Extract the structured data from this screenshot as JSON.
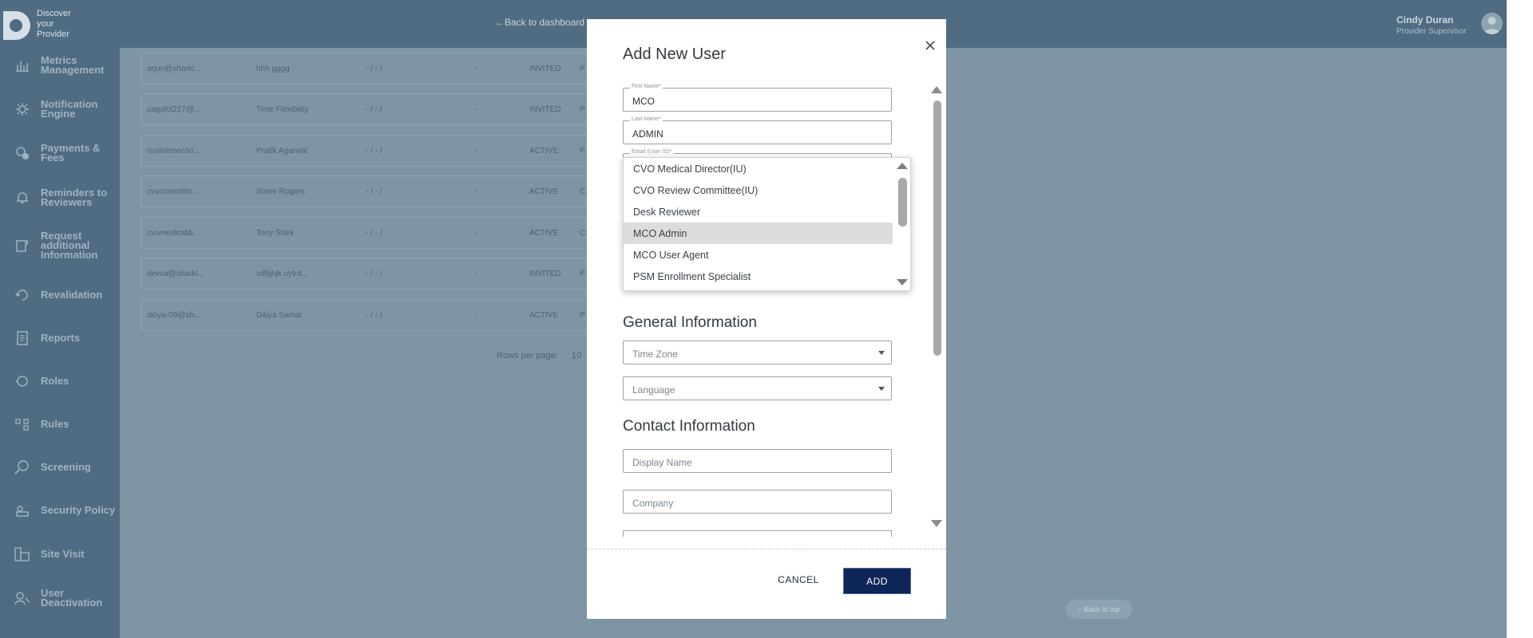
{
  "header": {
    "logo_lines": [
      "Discover",
      "your",
      "Provider"
    ],
    "back_link": "←Back to dashboard",
    "user_name": "Cindy Duran",
    "user_role": "Provider Supervisor"
  },
  "sidebar": {
    "items": [
      {
        "label": "Metrics Management",
        "icon": "bar-chart-icon"
      },
      {
        "label": "Notification Engine",
        "icon": "gear-icon"
      },
      {
        "label": "Payments & Fees",
        "icon": "payment-icon"
      },
      {
        "label": "Reminders to Reviewers",
        "icon": "bell-icon"
      },
      {
        "label": "Request additional Information",
        "icon": "request-info-icon"
      },
      {
        "label": "Revalidation",
        "icon": "revalidation-icon"
      },
      {
        "label": "Reports",
        "icon": "report-icon"
      },
      {
        "label": "Roles",
        "icon": "roles-icon"
      },
      {
        "label": "Rules",
        "icon": "rules-icon"
      },
      {
        "label": "Screening",
        "icon": "screening-icon"
      },
      {
        "label": "Security Policy",
        "icon": "security-icon"
      },
      {
        "label": "Site Visit",
        "icon": "site-visit-icon"
      },
      {
        "label": "User Deactivation",
        "icon": "user-deactivation-icon"
      }
    ]
  },
  "table": {
    "rows": [
      {
        "email": "arjun@sharkl...",
        "name": "hhh gggg",
        "date": "- / - /",
        "dash": "-",
        "status": "INVITED",
        "extra": "P"
      },
      {
        "email": "cagofol227@...",
        "name": "Time Flexibility",
        "date": "- / - /",
        "dash": "-",
        "status": "INVITED",
        "extra": "P"
      },
      {
        "email": "customsectio...",
        "name": "Pratik Agarwal",
        "date": "- / - /",
        "dash": "-",
        "status": "ACTIVE",
        "extra": "P"
      },
      {
        "email": "cvocommitte...",
        "name": "Steve Rogers",
        "date": "- / - /",
        "dash": "-",
        "status": "ACTIVE",
        "extra": "C"
      },
      {
        "email": "cvomedicaldi...",
        "name": "Tony Stark",
        "date": "- / - /",
        "dash": "-",
        "status": "ACTIVE",
        "extra": "C"
      },
      {
        "email": "devva@sharkl...",
        "name": "sdfghjk uytrd...",
        "date": "- / - /",
        "dash": "-",
        "status": "INVITED",
        "extra": "P"
      },
      {
        "email": "dibya-09@sh...",
        "name": "Dibya Samal",
        "date": "- / - /",
        "dash": "-",
        "status": "ACTIVE",
        "extra": "P"
      }
    ],
    "rows_per_page_label": "Rows per page:",
    "rows_per_page_value": "10",
    "back_to_top": "↑ Back to top"
  },
  "modal": {
    "title": "Add New User",
    "first_name": {
      "label": "First Name*",
      "value": "MCO"
    },
    "last_name": {
      "label": "Last Name*",
      "value": "ADMIN"
    },
    "email": {
      "label": "Email (User ID)*"
    },
    "general_title": "General Information",
    "time_zone": {
      "placeholder": "Time Zone"
    },
    "language": {
      "placeholder": "Language"
    },
    "contact_title": "Contact Information",
    "display_name": {
      "placeholder": "Display Name"
    },
    "company": {
      "placeholder": "Company"
    },
    "cancel_label": "CANCEL",
    "add_label": "ADD"
  },
  "role_dropdown": {
    "options": [
      "CVO Medical Director(IU)",
      "CVO Review Committee(IU)",
      "Desk Reviewer",
      "MCO Admin",
      "MCO User Agent",
      "PSM Enrollment Specialist"
    ],
    "selected": "MCO Admin"
  },
  "colors": {
    "header_bg": "#4f6c82",
    "overlay_bg": "#7e96a4",
    "primary_button": "#0d2557"
  }
}
